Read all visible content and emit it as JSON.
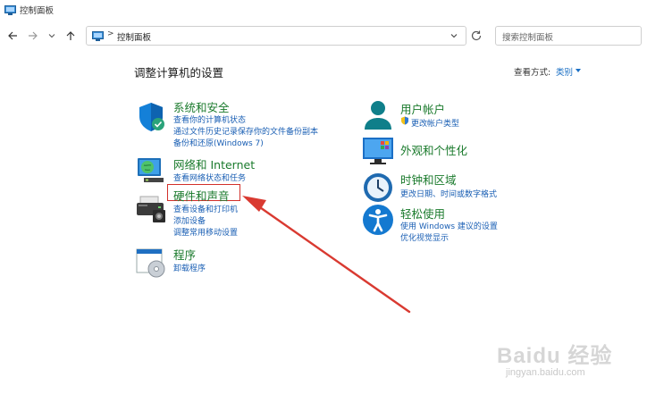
{
  "window": {
    "title": "控制面板"
  },
  "address_bar": {
    "path": "控制面板",
    "separator": ">"
  },
  "search": {
    "placeholder": "搜索控制面板"
  },
  "main": {
    "title": "调整计算机的设置",
    "view_by_label": "查看方式:",
    "view_by_value": "类别"
  },
  "categories_left": [
    {
      "title": "系统和安全",
      "links": [
        "查看你的计算机状态",
        "通过文件历史记录保存你的文件备份副本",
        "备份和还原(Windows 7)"
      ]
    },
    {
      "title": "网络和 Internet",
      "links": [
        "查看网络状态和任务"
      ]
    },
    {
      "title": "硬件和声音",
      "links": [
        "查看设备和打印机",
        "添加设备",
        "调整常用移动设置"
      ]
    },
    {
      "title": "程序",
      "links": [
        "卸载程序"
      ]
    }
  ],
  "categories_right": [
    {
      "title": "用户帐户",
      "links": [
        "更改帐户类型"
      ]
    },
    {
      "title": "外观和个性化",
      "links": []
    },
    {
      "title": "时钟和区域",
      "links": [
        "更改日期、时间或数字格式"
      ]
    },
    {
      "title": "轻松使用",
      "links": [
        "使用 Windows 建议的设置",
        "优化视觉显示"
      ]
    }
  ],
  "watermark": {
    "brand": "Baidu 经验",
    "url": "jingyan.baidu.com"
  },
  "colors": {
    "category_title": "#1a7a2c",
    "link": "#1a5fb4",
    "annotation": "#d2302b"
  }
}
